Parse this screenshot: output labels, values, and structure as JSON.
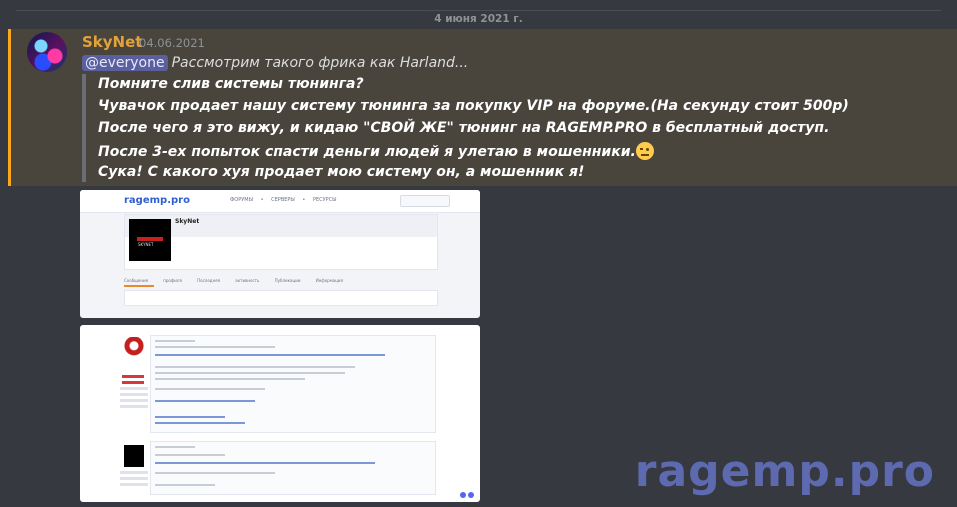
{
  "divider": {
    "date": "4 июня 2021 г."
  },
  "message": {
    "author": "SkyNet",
    "timestamp": "04.06.2021",
    "author_color": "#e3a33a",
    "mention": "@everyone",
    "preview": "Рассмотрим такого фрика как Harland...",
    "quote_lines": [
      "Помните слив системы тюнинга?",
      "Чувачок продает нашу систему тюнинга за покупку VIP на форуме.(На секунду стоит 500р)",
      "После чего я это вижу, и кидаю \"СВОЙ ЖЕ\" тюнинг на RAGEMP.PRO в бесплатный доступ.",
      "После 3-ех попыток спасти деньги людей я улетаю в мошенники.",
      "Сука! С какого хуя продает мою систему он, а мошенник я!"
    ],
    "emoji": "face-with-raised-eyebrow-emoji"
  },
  "attachments": {
    "profile": {
      "logo": "ragemp.pro",
      "nav": "ФОРУМЫ • СЕРВЕРЫ • РЕСУРСЫ",
      "username": "SkyNet",
      "tabs": "Сообщения профиля Последняя активность Публикации Информация"
    }
  },
  "watermark": "ragemp.pro",
  "colors": {
    "background": "#36393f",
    "highlight": "#49443c",
    "highlight_border": "#faa81a",
    "mention_bg": "#5a5f9e"
  }
}
